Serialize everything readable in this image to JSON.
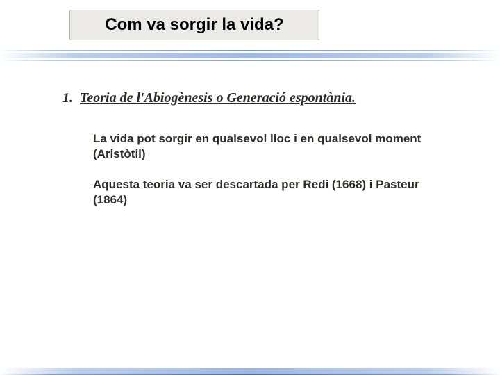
{
  "title": "Com va sorgir la vida?",
  "section": {
    "number": "1.",
    "heading": "Teoria de l'Abiogènesis o Generació espontània.",
    "paragraphs": [
      "La vida pot sorgir en qualsevol lloc i en qualsevol moment (Aristòtil)",
      "Aquesta teoria va ser descartada per Redi (1668) i Pasteur (1864)"
    ]
  }
}
